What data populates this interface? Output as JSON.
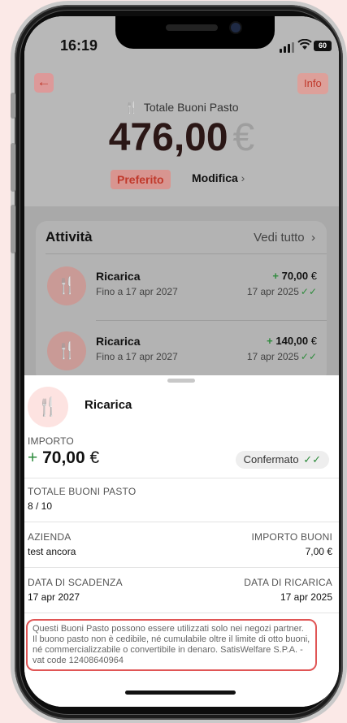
{
  "status": {
    "time": "16:19",
    "battery": "60"
  },
  "header": {
    "info_label": "Info",
    "total_label": "Totale Buoni Pasto",
    "amount": "476,00",
    "currency": "€",
    "favorite_label": "Preferito",
    "edit_label": "Modifica"
  },
  "activity": {
    "title": "Attività",
    "see_all": "Vedi tutto",
    "items": [
      {
        "name": "Ricarica",
        "subtitle": "Fino a 17 apr 2027",
        "sign": "+",
        "amount": "70,00",
        "currency": "€",
        "date": "17 apr 2025"
      },
      {
        "name": "Ricarica",
        "subtitle": "Fino a 17 apr 2027",
        "sign": "+",
        "amount": "140,00",
        "currency": "€",
        "date": "17 apr 2025"
      }
    ]
  },
  "detail": {
    "title": "Ricarica",
    "importo_label": "IMPORTO",
    "importo_sign": "+",
    "importo_value": "70,00",
    "importo_currency": "€",
    "status_label": "Confermato",
    "totale_label": "TOTALE BUONI PASTO",
    "totale_value": "8 / 10",
    "azienda_label": "AZIENDA",
    "azienda_value": "test ancora",
    "importo_buoni_label": "IMPORTO BUONI",
    "importo_buoni_value": "7,00 €",
    "scadenza_label": "DATA DI SCADENZA",
    "scadenza_value": "17 apr 2027",
    "ricarica_label": "DATA DI RICARICA",
    "ricarica_value": "17 apr 2025",
    "disclaimer": "Questi Buoni Pasto possono essere utilizzati solo nei negozi partner. Il buono pasto non è cedibile, né cumulabile oltre il limite di otto buoni, né commercializzabile o convertibile in denaro. SatisWelfare S.P.A. - vat code 12408640964"
  },
  "icons": {
    "back": "arrow-left-icon",
    "fork_knife": "fork-knife-icon",
    "check": "double-check-icon",
    "chevron": "chevron-right-icon"
  }
}
